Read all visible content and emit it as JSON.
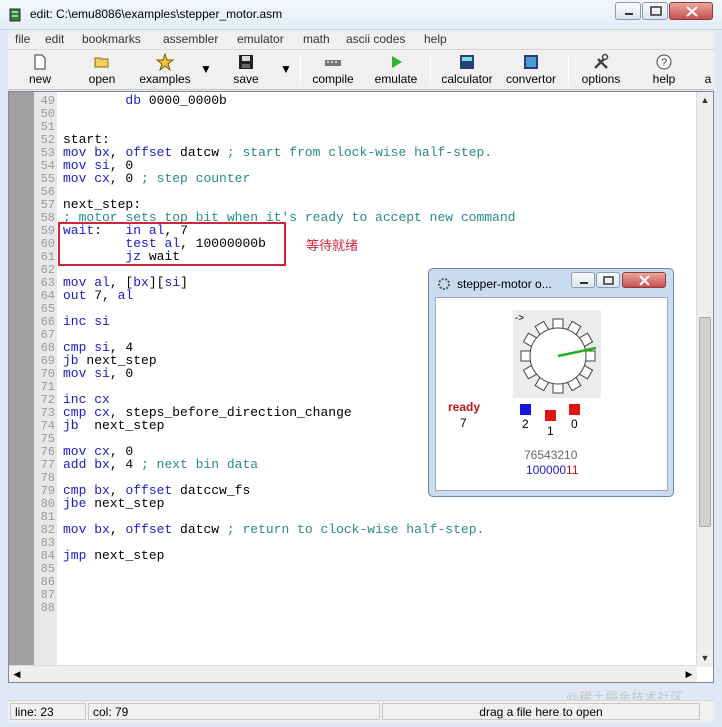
{
  "window": {
    "title": "edit: C:\\emu8086\\examples\\stepper_motor.asm"
  },
  "menu": [
    "file",
    "edit",
    "bookmarks",
    "assembler",
    "emulator",
    "math",
    "ascii codes",
    "help"
  ],
  "toolbar": {
    "new": "new",
    "open": "open",
    "examples": "examples",
    "save": "save",
    "compile": "compile",
    "emulate": "emulate",
    "calculator": "calculator",
    "convertor": "convertor",
    "options": "options",
    "help": "help",
    "about_partial": "a"
  },
  "code": [
    {
      "n": "49",
      "t": "        db 0000_0000b"
    },
    {
      "n": "50",
      "t": ""
    },
    {
      "n": "51",
      "t": ""
    },
    {
      "n": "52",
      "t": "start:"
    },
    {
      "n": "53",
      "t": "mov bx, offset datcw ; start from clock-wise half-step."
    },
    {
      "n": "54",
      "t": "mov si, 0"
    },
    {
      "n": "55",
      "t": "mov cx, 0 ; step counter"
    },
    {
      "n": "56",
      "t": ""
    },
    {
      "n": "57",
      "t": "next_step:"
    },
    {
      "n": "58",
      "t": "; motor sets top bit when it's ready to accept new command"
    },
    {
      "n": "59",
      "t": "wait:   in al, 7"
    },
    {
      "n": "60",
      "t": "        test al, 10000000b"
    },
    {
      "n": "61",
      "t": "        jz wait"
    },
    {
      "n": "62",
      "t": ""
    },
    {
      "n": "63",
      "t": "mov al, [bx][si]"
    },
    {
      "n": "64",
      "t": "out 7, al"
    },
    {
      "n": "65",
      "t": ""
    },
    {
      "n": "66",
      "t": "inc si"
    },
    {
      "n": "67",
      "t": ""
    },
    {
      "n": "68",
      "t": "cmp si, 4"
    },
    {
      "n": "69",
      "t": "jb next_step"
    },
    {
      "n": "70",
      "t": "mov si, 0"
    },
    {
      "n": "71",
      "t": ""
    },
    {
      "n": "72",
      "t": "inc cx"
    },
    {
      "n": "73",
      "t": "cmp cx, steps_before_direction_change"
    },
    {
      "n": "74",
      "t": "jb  next_step"
    },
    {
      "n": "75",
      "t": ""
    },
    {
      "n": "76",
      "t": "mov cx, 0"
    },
    {
      "n": "77",
      "t": "add bx, 4 ; next bin data"
    },
    {
      "n": "78",
      "t": ""
    },
    {
      "n": "79",
      "t": "cmp bx, offset datccw_fs"
    },
    {
      "n": "80",
      "t": "jbe next_step"
    },
    {
      "n": "81",
      "t": ""
    },
    {
      "n": "82",
      "t": "mov bx, offset datcw ; return to clock-wise half-step."
    },
    {
      "n": "83",
      "t": ""
    },
    {
      "n": "84",
      "t": "jmp next_step"
    },
    {
      "n": "85",
      "t": ""
    },
    {
      "n": "86",
      "t": ""
    },
    {
      "n": "87",
      "t": ""
    },
    {
      "n": "88",
      "t": ""
    }
  ],
  "annotation": "等待就绪",
  "popup": {
    "title": "stepper-motor o...",
    "ready_label": "ready",
    "ready_value": "7",
    "pins": [
      "2",
      "1",
      "0"
    ],
    "bits_header": "76543210",
    "bits_blue": "100000",
    "bits_red": "11",
    "pointer": "->"
  },
  "status": {
    "line": "line: 23",
    "col": "col: 79",
    "hint": "drag a file here to open"
  },
  "watermark": "@稀土掘金技术社区",
  "colors": {
    "keyword": "#1b1bc8",
    "comment": "#2a8a8a",
    "annotation": "#d0243a"
  }
}
